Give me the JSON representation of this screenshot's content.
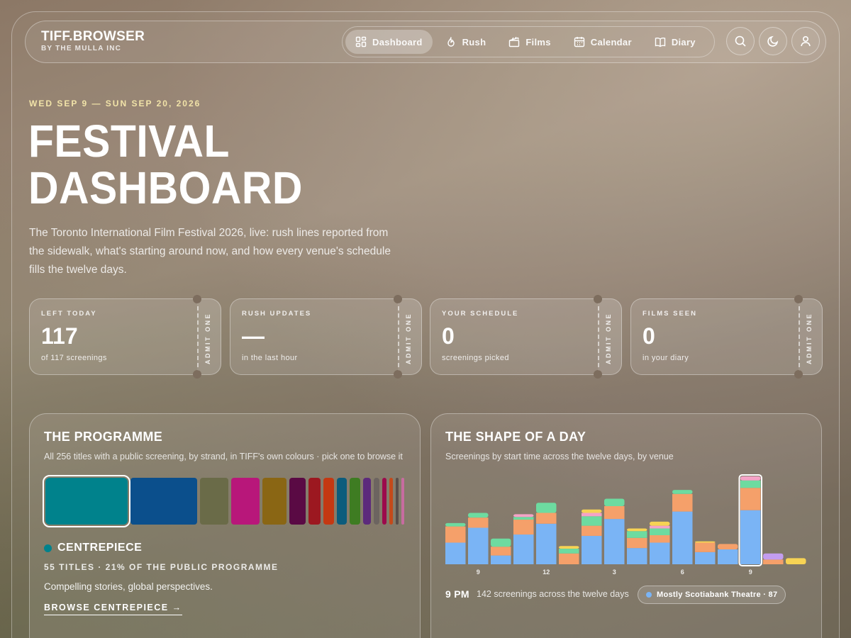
{
  "brand": {
    "name": "TIFF.BROWSER",
    "subtitle": "BY THE MULLA INC"
  },
  "nav": [
    {
      "label": "Dashboard",
      "icon": "dashboard-icon",
      "active": true
    },
    {
      "label": "Rush",
      "icon": "flame-icon"
    },
    {
      "label": "Films",
      "icon": "clapperboard-icon"
    },
    {
      "label": "Calendar",
      "icon": "calendar-icon"
    },
    {
      "label": "Diary",
      "icon": "book-icon"
    }
  ],
  "header_actions": [
    "search-icon",
    "moon-icon",
    "user-icon"
  ],
  "hero": {
    "dates": "WED SEP 9 — SUN SEP 20, 2026",
    "title_line1": "FESTIVAL",
    "title_line2": "DASHBOARD",
    "description": "The Toronto International Film Festival 2026, live: rush lines reported from the sidewalk, what's starting around now, and how every venue's schedule fills the twelve days."
  },
  "stats": [
    {
      "label": "LEFT TODAY",
      "value": "117",
      "sub": "of 117 screenings",
      "stub": "ADMIT ONE"
    },
    {
      "label": "RUSH UPDATES",
      "value": "—",
      "sub": "in the last hour",
      "stub": "ADMIT ONE"
    },
    {
      "label": "YOUR SCHEDULE",
      "value": "0",
      "sub": "screenings picked",
      "stub": "ADMIT ONE"
    },
    {
      "label": "FILMS SEEN",
      "value": "0",
      "sub": "in your diary",
      "stub": "ADMIT ONE"
    }
  ],
  "programme": {
    "title": "THE PROGRAMME",
    "subtitle": "All 256 titles with a public screening, by strand, in TIFF's own colours · pick one to browse it",
    "strands": [
      {
        "color": "#00828c",
        "share": 55,
        "selected": true
      },
      {
        "color": "#0b4f8c",
        "share": 45
      },
      {
        "color": "#6a6b48",
        "share": 19
      },
      {
        "color": "#b8177a",
        "share": 19
      },
      {
        "color": "#8a6614",
        "share": 16
      },
      {
        "color": "#5a0a44",
        "share": 11
      },
      {
        "color": "#9c1820",
        "share": 8
      },
      {
        "color": "#c43812",
        "share": 7
      },
      {
        "color": "#0c5c7c",
        "share": 7
      },
      {
        "color": "#3e7c22",
        "share": 7
      },
      {
        "color": "#5c2a7c",
        "share": 5
      },
      {
        "color": "#6c6460",
        "share": 4
      },
      {
        "color": "#9c0a4c",
        "share": 3
      },
      {
        "color": "#c44a1a",
        "share": 2
      },
      {
        "color": "#5a4e4a",
        "share": 2
      },
      {
        "color": "#c86ca0",
        "share": 2
      }
    ],
    "selected": {
      "name": "CENTREPIECE",
      "color": "#00828c",
      "meta": "55 TITLES · 21% OF THE PUBLIC PROGRAMME",
      "description": "Compelling stories, global perspectives.",
      "browse_label": "BROWSE CENTREPIECE →"
    }
  },
  "shape": {
    "title": "THE SHAPE OF A DAY",
    "subtitle": "Screenings by start time across the twelve days, by venue",
    "time_label": "9 PM",
    "time_desc": "142 screenings across the twelve days",
    "venue_label": "Mostly Scotiabank Theatre · 87",
    "venue_color": "#7ab4f5"
  },
  "chart_data": {
    "type": "bar",
    "stacked": true,
    "title": "THE SHAPE OF A DAY",
    "x_tick_labels": [
      "9",
      "12",
      "3",
      "6",
      "9"
    ],
    "selected_index": 13,
    "series_colors": [
      "#7ab4f5",
      "#f5a06a",
      "#6ddba0",
      "#f5a3c7",
      "#f7d354",
      "#c39df0"
    ],
    "stacks": [
      [
        32,
        24,
        5,
        0,
        0,
        0
      ],
      [
        54,
        15,
        7,
        0,
        0,
        0
      ],
      [
        13,
        13,
        12,
        0,
        0,
        0
      ],
      [
        44,
        22,
        4,
        4,
        0,
        0
      ],
      [
        60,
        16,
        15,
        0,
        0,
        0
      ],
      [
        0,
        16,
        7,
        0,
        4,
        0
      ],
      [
        42,
        15,
        14,
        5,
        5,
        0
      ],
      [
        67,
        19,
        11,
        0,
        0,
        0
      ],
      [
        24,
        15,
        10,
        0,
        4,
        0
      ],
      [
        32,
        11,
        10,
        4,
        6,
        0
      ],
      [
        78,
        26,
        6,
        0,
        0,
        0
      ],
      [
        18,
        14,
        0,
        0,
        2,
        0
      ],
      [
        22,
        8,
        0,
        0,
        0,
        0
      ],
      [
        80,
        33,
        11,
        6,
        0,
        0
      ],
      [
        0,
        7,
        0,
        0,
        0,
        9
      ],
      [
        0,
        0,
        0,
        0,
        9,
        0
      ]
    ]
  }
}
